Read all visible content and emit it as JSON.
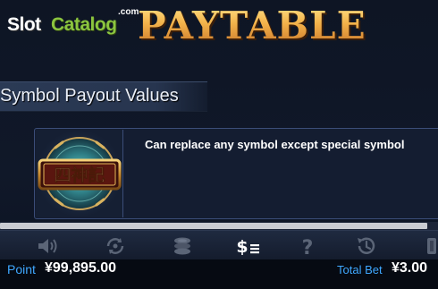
{
  "header": {
    "logo_slot": "Slot",
    "logo_catalog": "Catalog",
    "logo_com": ".com",
    "title": "PAYTABLE"
  },
  "section": {
    "title": "Symbol Payout Values"
  },
  "symbol": {
    "glyph_text": "四神記",
    "description": "Can replace any symbol except special symbol"
  },
  "scroll": {
    "position_fraction": 0.98
  },
  "toolbar": {
    "items": [
      {
        "name": "sound-icon",
        "active": false
      },
      {
        "name": "autospin-icon",
        "active": false
      },
      {
        "name": "coins-icon",
        "active": false
      },
      {
        "name": "paytable-icon",
        "active": true
      },
      {
        "name": "help-icon",
        "active": false
      },
      {
        "name": "history-icon",
        "active": false
      },
      {
        "name": "more-icon",
        "active": false
      }
    ]
  },
  "status": {
    "point_label": "Point",
    "point_value": "¥99,895.00",
    "bet_label": "Total Bet",
    "bet_value": "¥3.00"
  },
  "colors": {
    "accent_blue": "#3fa8ff",
    "title_gold": "#f3b24a",
    "logo_green": "#8bc53f",
    "icon_inactive": "#5b6577",
    "icon_active": "#ffffff"
  }
}
